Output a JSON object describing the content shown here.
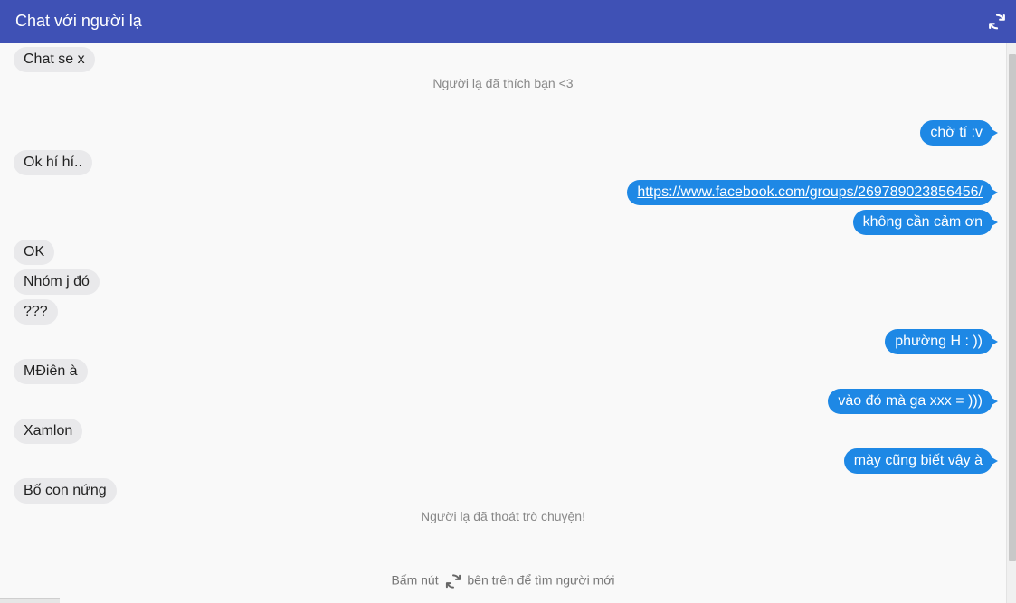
{
  "header": {
    "title": "Chat với người lạ",
    "refresh_icon": "refresh-icon"
  },
  "messages": [
    {
      "side": "in",
      "text": "Chat se x"
    },
    {
      "side": "system",
      "text": "Người lạ đã thích bạn <3"
    },
    {
      "side": "out",
      "text": "chờ tí :v"
    },
    {
      "side": "in",
      "text": "Ok hí hí.."
    },
    {
      "side": "out",
      "text": "https://www.facebook.com/groups/269789023856456/",
      "link": true
    },
    {
      "side": "out",
      "text": "không cần cảm ơn"
    },
    {
      "side": "in",
      "text": "OK"
    },
    {
      "side": "in",
      "text": "Nhóm j đó"
    },
    {
      "side": "in",
      "text": "???"
    },
    {
      "side": "out",
      "text": "phường H : ))"
    },
    {
      "side": "in",
      "text": "MĐiên à"
    },
    {
      "side": "out",
      "text": "vào đó mà ga xxx = )))"
    },
    {
      "side": "in",
      "text": "Xamlon"
    },
    {
      "side": "out",
      "text": "mày cũng biết vậy à"
    },
    {
      "side": "in",
      "text": "Bố con nứng"
    },
    {
      "side": "system",
      "text": "Người lạ đã thoát trò chuyện!"
    }
  ],
  "footer": {
    "before": "Bấm nút",
    "after": "bên trên để tìm người mới"
  },
  "colors": {
    "header": "#3f51b5",
    "outgoing": "#1e88e5",
    "incoming": "#e9e9eb"
  }
}
